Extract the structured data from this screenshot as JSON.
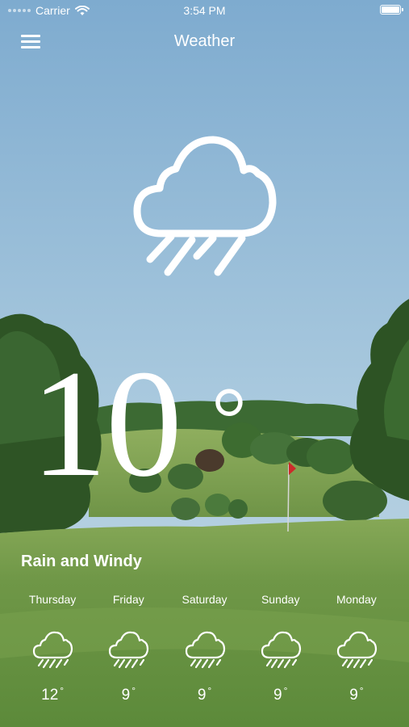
{
  "status_bar": {
    "carrier": "Carrier",
    "time": "3:54 PM"
  },
  "nav": {
    "title": "Weather",
    "menu_icon": "hamburger-menu-icon"
  },
  "current": {
    "icon": "cloud-rain-icon",
    "temperature": "10",
    "degree_symbol": "°",
    "condition": "Rain and Windy"
  },
  "forecast": [
    {
      "day": "Thursday",
      "icon": "cloud-rain-icon",
      "temp": "12",
      "deg": "°"
    },
    {
      "day": "Friday",
      "icon": "cloud-rain-icon",
      "temp": "9",
      "deg": "°"
    },
    {
      "day": "Saturday",
      "icon": "cloud-rain-icon",
      "temp": "9",
      "deg": "°"
    },
    {
      "day": "Sunday",
      "icon": "cloud-rain-icon",
      "temp": "9",
      "deg": "°"
    },
    {
      "day": "Monday",
      "icon": "cloud-rain-icon",
      "temp": "9",
      "deg": "°"
    }
  ],
  "colors": {
    "sky_top": "#7fadd0",
    "sky_bottom": "#b2cfdf",
    "grass": "#6b9444",
    "trees": "#2f5726",
    "text": "#ffffff"
  }
}
